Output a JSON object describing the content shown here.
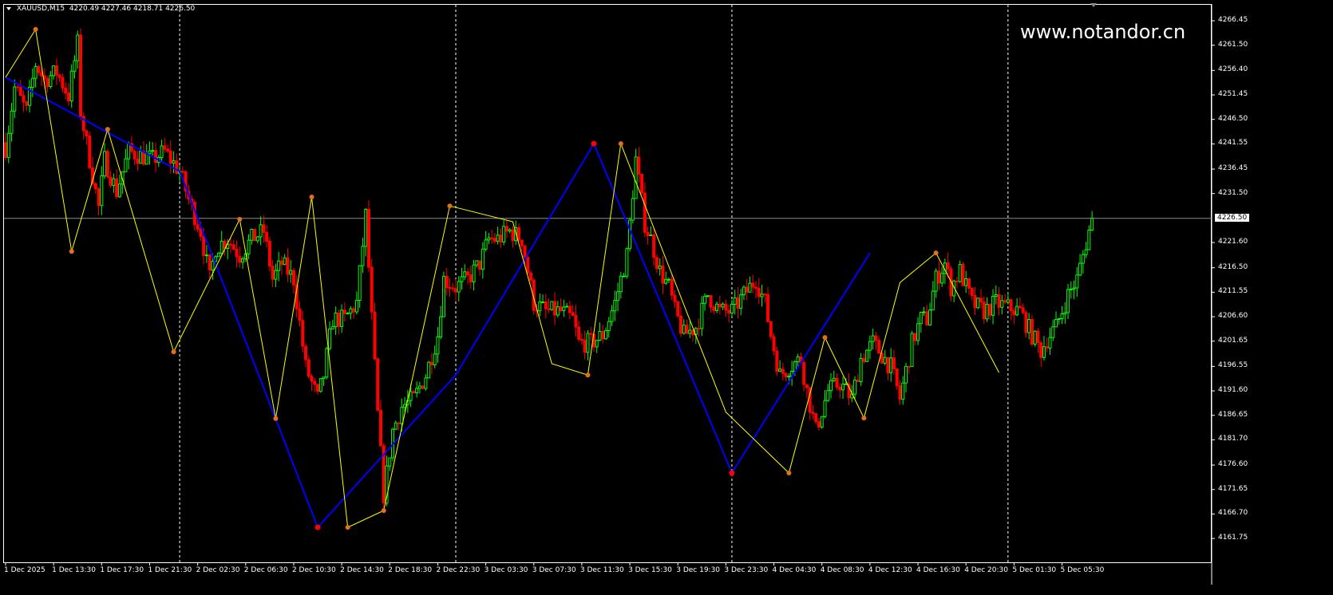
{
  "header": {
    "symbol": "XAUUSD,M15",
    "ohlc": "4220.49 4227.46 4218.71 4226.50"
  },
  "watermark": "www.notandor.cn",
  "colors": {
    "bull": "#00ff00",
    "bear": "#ff0000",
    "zigzag_fast": "#ffff00",
    "zigzag_slow": "#0000ff",
    "marker": "#e07020",
    "marker_slow": "#ff0000",
    "price_line": "#8c8c8c",
    "grid_sep": "#ffffff"
  },
  "chart_data": {
    "type": "candlestick",
    "symbol": "XAUUSD",
    "timeframe": "M15",
    "current_price": 4226.5,
    "ylim": [
      4161.75,
      4269.5
    ],
    "candle_count": 363,
    "price_ticks": [
      "4266.45",
      "4261.50",
      "4256.40",
      "4251.45",
      "4246.50",
      "4241.55",
      "4236.45",
      "4231.50",
      "4221.60",
      "4216.50",
      "4211.55",
      "4206.60",
      "4201.65",
      "4196.55",
      "4191.60",
      "4186.65",
      "4181.70",
      "4176.60",
      "4171.65",
      "4166.70",
      "4161.75"
    ],
    "time_labels": [
      "1 Dec 2025",
      "1 Dec 13:30",
      "1 Dec 17:30",
      "1 Dec 21:30",
      "2 Dec 02:30",
      "2 Dec 06:30",
      "2 Dec 10:30",
      "2 Dec 14:30",
      "2 Dec 18:30",
      "2 Dec 22:30",
      "3 Dec 03:30",
      "3 Dec 07:30",
      "3 Dec 11:30",
      "3 Dec 15:30",
      "3 Dec 19:30",
      "3 Dec 23:30",
      "4 Dec 04:30",
      "4 Dec 08:30",
      "4 Dec 12:30",
      "4 Dec 16:30",
      "4 Dec 20:30",
      "5 Dec 01:30",
      "5 Dec 05:30"
    ],
    "time_label_step_bars": 16,
    "day_separators_bar": [
      58,
      150,
      242,
      334
    ],
    "close_path": [
      [
        0,
        4240.8
      ],
      [
        3,
        4252.9
      ],
      [
        7,
        4248.1
      ],
      [
        10,
        4257.7
      ],
      [
        13,
        4254.5
      ],
      [
        17,
        4256.1
      ],
      [
        21,
        4251.3
      ],
      [
        24,
        4261.8
      ],
      [
        25,
        4248.1
      ],
      [
        28,
        4238.4
      ],
      [
        31,
        4228.7
      ],
      [
        33,
        4238.4
      ],
      [
        37,
        4231.9
      ],
      [
        41,
        4240.0
      ],
      [
        45,
        4239.2
      ],
      [
        49,
        4238.4
      ],
      [
        53,
        4240.0
      ],
      [
        58,
        4236.0
      ],
      [
        61,
        4230.3
      ],
      [
        65,
        4223.9
      ],
      [
        68,
        4214.2
      ],
      [
        70,
        4220.6
      ],
      [
        74,
        4222.3
      ],
      [
        78,
        4219.0
      ],
      [
        82,
        4222.3
      ],
      [
        86,
        4223.9
      ],
      [
        89,
        4214.2
      ],
      [
        92,
        4217.4
      ],
      [
        96,
        4214.2
      ],
      [
        100,
        4196.4
      ],
      [
        104,
        4190.0
      ],
      [
        106,
        4194.8
      ],
      [
        109,
        4206.1
      ],
      [
        113,
        4206.1
      ],
      [
        117,
        4209.4
      ],
      [
        120,
        4227.1
      ],
      [
        122,
        4206.1
      ],
      [
        124,
        4186.8
      ],
      [
        126,
        4170.6
      ],
      [
        129,
        4183.6
      ],
      [
        132,
        4188.4
      ],
      [
        136,
        4190.0
      ],
      [
        140,
        4194.8
      ],
      [
        144,
        4202.9
      ],
      [
        146,
        4214.2
      ],
      [
        150,
        4212.6
      ],
      [
        154,
        4214.2
      ],
      [
        158,
        4217.4
      ],
      [
        161,
        4222.3
      ],
      [
        164,
        4222.3
      ],
      [
        168,
        4223.9
      ],
      [
        172,
        4222.3
      ],
      [
        176,
        4209.4
      ],
      [
        180,
        4207.7
      ],
      [
        185,
        4207.7
      ],
      [
        189,
        4206.1
      ],
      [
        191,
        4201.3
      ],
      [
        195,
        4201.3
      ],
      [
        199,
        4202.9
      ],
      [
        203,
        4209.4
      ],
      [
        207,
        4219.0
      ],
      [
        210,
        4238.4
      ],
      [
        213,
        4225.5
      ],
      [
        215,
        4222.3
      ],
      [
        218,
        4215.8
      ],
      [
        221,
        4212.6
      ],
      [
        223,
        4207.7
      ],
      [
        226,
        4202.9
      ],
      [
        230,
        4204.5
      ],
      [
        234,
        4211.0
      ],
      [
        238,
        4207.7
      ],
      [
        242,
        4207.7
      ],
      [
        246,
        4211.0
      ],
      [
        250,
        4214.2
      ],
      [
        253,
        4209.4
      ],
      [
        255,
        4202.9
      ],
      [
        258,
        4194.8
      ],
      [
        261,
        4196.4
      ],
      [
        265,
        4198.1
      ],
      [
        267,
        4191.6
      ],
      [
        270,
        4183.6
      ],
      [
        274,
        4191.6
      ],
      [
        278,
        4193.2
      ],
      [
        282,
        4190.0
      ],
      [
        285,
        4198.1
      ],
      [
        289,
        4201.3
      ],
      [
        291,
        4199.7
      ],
      [
        295,
        4196.4
      ],
      [
        298,
        4190.0
      ],
      [
        302,
        4201.3
      ],
      [
        305,
        4206.1
      ],
      [
        307,
        4206.1
      ],
      [
        310,
        4214.2
      ],
      [
        313,
        4217.4
      ],
      [
        315,
        4212.6
      ],
      [
        318,
        4215.8
      ],
      [
        322,
        4209.4
      ],
      [
        326,
        4207.7
      ],
      [
        330,
        4209.4
      ],
      [
        334,
        4208.5
      ],
      [
        338,
        4207.7
      ],
      [
        342,
        4202.9
      ],
      [
        345,
        4199.7
      ],
      [
        347,
        4202.1
      ],
      [
        350,
        4204.5
      ],
      [
        354,
        4211.0
      ],
      [
        357,
        4214.2
      ],
      [
        359,
        4219.0
      ],
      [
        362,
        4226.5
      ]
    ],
    "zigzag_fast": [
      [
        0,
        4255.0,
        0
      ],
      [
        10,
        4264.7,
        1
      ],
      [
        22,
        4219.8,
        1
      ],
      [
        34,
        4244.5,
        1
      ],
      [
        56,
        4199.5,
        1
      ],
      [
        78,
        4226.3,
        1
      ],
      [
        90,
        4186.0,
        1
      ],
      [
        102,
        4230.8,
        1
      ],
      [
        114,
        4164.0,
        1
      ],
      [
        126,
        4167.4,
        1
      ],
      [
        148,
        4229.0,
        1
      ],
      [
        169,
        4225.8,
        0
      ],
      [
        182,
        4197.1,
        0
      ],
      [
        194,
        4194.8,
        1
      ],
      [
        205,
        4241.6,
        1
      ],
      [
        240,
        4187.3,
        0
      ],
      [
        261,
        4175.0,
        1
      ],
      [
        273,
        4202.4,
        1
      ],
      [
        286,
        4186.1,
        1
      ],
      [
        298,
        4213.5,
        0
      ],
      [
        310,
        4219.5,
        1
      ],
      [
        331,
        4195.3,
        0
      ]
    ],
    "zigzag_slow": [
      [
        0,
        4255.0,
        0
      ],
      [
        58,
        4236.0,
        0
      ],
      [
        104,
        4164.0,
        1
      ],
      [
        150,
        4194.8,
        0
      ],
      [
        196,
        4241.6,
        1
      ],
      [
        242,
        4175.0,
        1
      ],
      [
        288,
        4219.5,
        0
      ]
    ]
  }
}
